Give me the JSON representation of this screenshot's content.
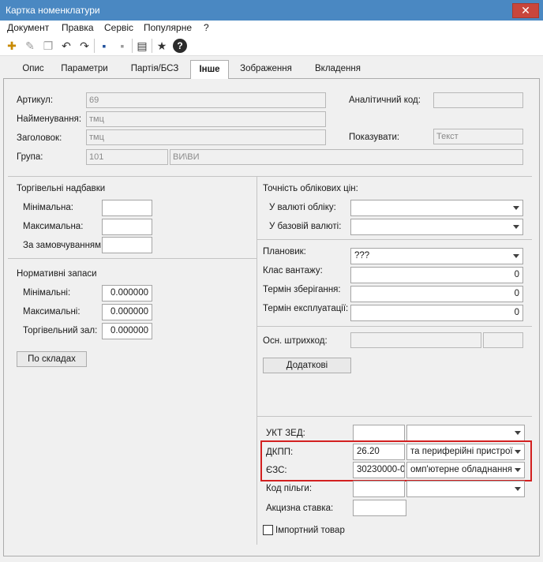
{
  "window": {
    "title": "Картка номенклатури",
    "close_glyph": "✕"
  },
  "menu": [
    "Документ",
    "Правка",
    "Сервіс",
    "Популярне",
    "?"
  ],
  "toolbar": {
    "icons": [
      "new-icon",
      "edit-icon",
      "copy-icon",
      "undo-icon",
      "redo-icon",
      "save-icon",
      "save-disabled-icon",
      "calc-icon",
      "star-icon",
      "help-icon"
    ],
    "glyphs": {
      "new": "✚",
      "edit": "✎",
      "copy": "❐",
      "undo": "↶",
      "redo": "↷",
      "save": "▪",
      "save_dim": "▪",
      "calc": "▤",
      "star": "★",
      "help": "?"
    }
  },
  "tabs": [
    "Опис",
    "Параметри",
    "Партія/БСЗ",
    "Інше",
    "Зображення",
    "Вкладення"
  ],
  "active_tab": "Інше",
  "top": {
    "article_label": "Артикул:",
    "article_value": "69",
    "name_label": "Найменування:",
    "name_value": "тмц",
    "heading_label": "Заголовок:",
    "heading_value": "тмц",
    "group_label": "Група:",
    "group_code": "101",
    "group_name": "ВИ\\ВИ",
    "analytic_label": "Аналітичний код:",
    "analytic_value": "",
    "show_label": "Показувати:",
    "show_value": "Текст"
  },
  "markups": {
    "title": "Торгівельні надбавки",
    "min_label": "Мінімальна:",
    "max_label": "Максимальна:",
    "order_label": "За замовчуванням:",
    "min_value": "",
    "max_value": "",
    "order_value": ""
  },
  "stock": {
    "title": "Нормативні запаси",
    "min_label": "Мінімальні:",
    "min_value": "0.000000",
    "max_label": "Максимальні:",
    "max_value": "0.000000",
    "hall_label": "Торгівельний зал:",
    "hall_value": "0.000000",
    "by_warehouses": "По складах"
  },
  "precision": {
    "title": "Точність облікових цін:",
    "acc_label": "У валюті обліку:",
    "acc_value": "",
    "base_label": "У базовій валюті:",
    "base_value": ""
  },
  "planning": {
    "planner_label": "Плановик:",
    "planner_value": "???",
    "cargo_label": "Клас вантажу:",
    "cargo_value": "0",
    "storage_label": "Термін зберігання:",
    "storage_value": "0",
    "exploit_label": "Термін експлуатації:",
    "exploit_value": "0"
  },
  "barcode": {
    "label": "Осн. штрихкод:",
    "value": "",
    "extra": "",
    "additional": "Додаткові"
  },
  "codes": {
    "ukt_label": "УКТ ЗЕД:",
    "ukt_code": "",
    "ukt_name": "",
    "dkpp_label": "ДКПП:",
    "dkpp_code": "26.20",
    "dkpp_name": "та периферійні пристрої",
    "ezs_label": "ЄЗС:",
    "ezs_code": "30230000-0",
    "ezs_name": "омп'ютерне обладнання",
    "benefit_label": "Код пільги:",
    "benefit_code": "",
    "benefit_name": "",
    "excise_label": "Акцизна ставка:",
    "excise_value": "",
    "import_label": "Імпортний товар",
    "import_checked": false
  },
  "colors": {
    "titlebar": "#4a88c2",
    "close": "#c9463c",
    "highlight": "#d32020"
  }
}
